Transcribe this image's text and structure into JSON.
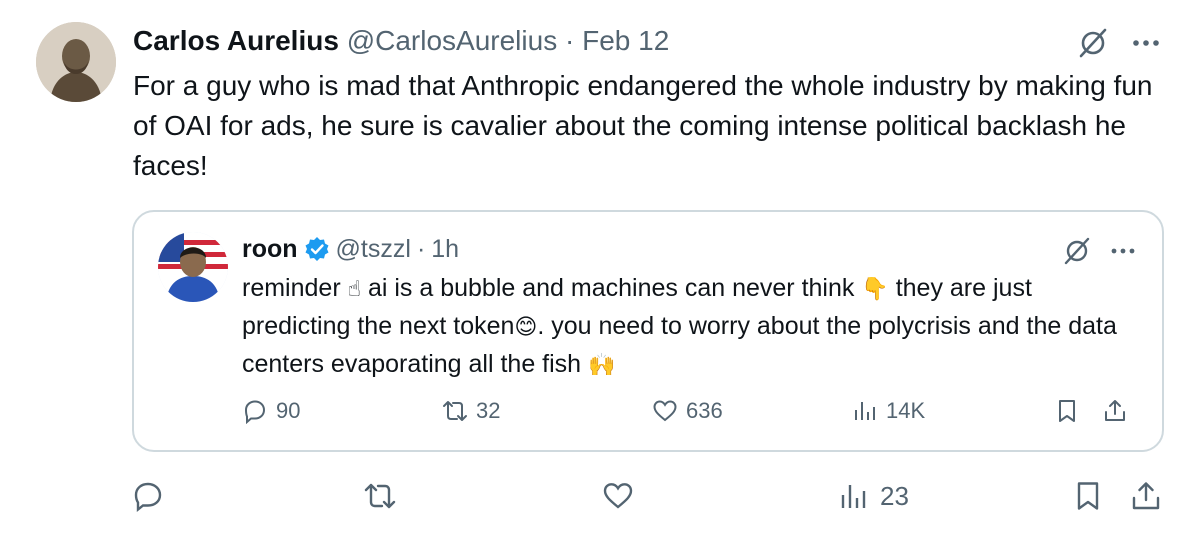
{
  "tweet": {
    "author_name": "Carlos Aurelius",
    "author_handle": "@CarlosAurelius",
    "separator": "·",
    "date": "Feb 12",
    "text": "For a guy who is mad that Anthropic endangered the whole industry by making fun of OAI for ads, he sure is cavalier about the coming intense political backlash he faces!",
    "actions": {
      "replies": "",
      "retweets": "",
      "likes": "",
      "views": "23"
    }
  },
  "quote": {
    "author_name": "roon",
    "author_handle": "@tszzl",
    "separator": "·",
    "time": "1h",
    "text_parts": {
      "p1": "reminder",
      "e1": "☝",
      "p2": "ai is a bubble and machines can never think",
      "e2": "👇",
      "p3": "they are just predicting the next token",
      "e3": "😊",
      "p4": ". you need to worry about the polycrisis and the data centers evaporating all the fish",
      "e4": "🙌"
    },
    "actions": {
      "replies": "90",
      "retweets": "32",
      "likes": "636",
      "views": "14K"
    }
  },
  "colors": {
    "text": "#0f1419",
    "muted": "#536471",
    "border": "#cfd9de",
    "verified": "#1d9bf0"
  },
  "icons": [
    "grok-icon",
    "more-icon",
    "verified-badge-icon",
    "reply-icon",
    "retweet-icon",
    "like-icon",
    "views-icon",
    "bookmark-icon",
    "share-icon"
  ]
}
